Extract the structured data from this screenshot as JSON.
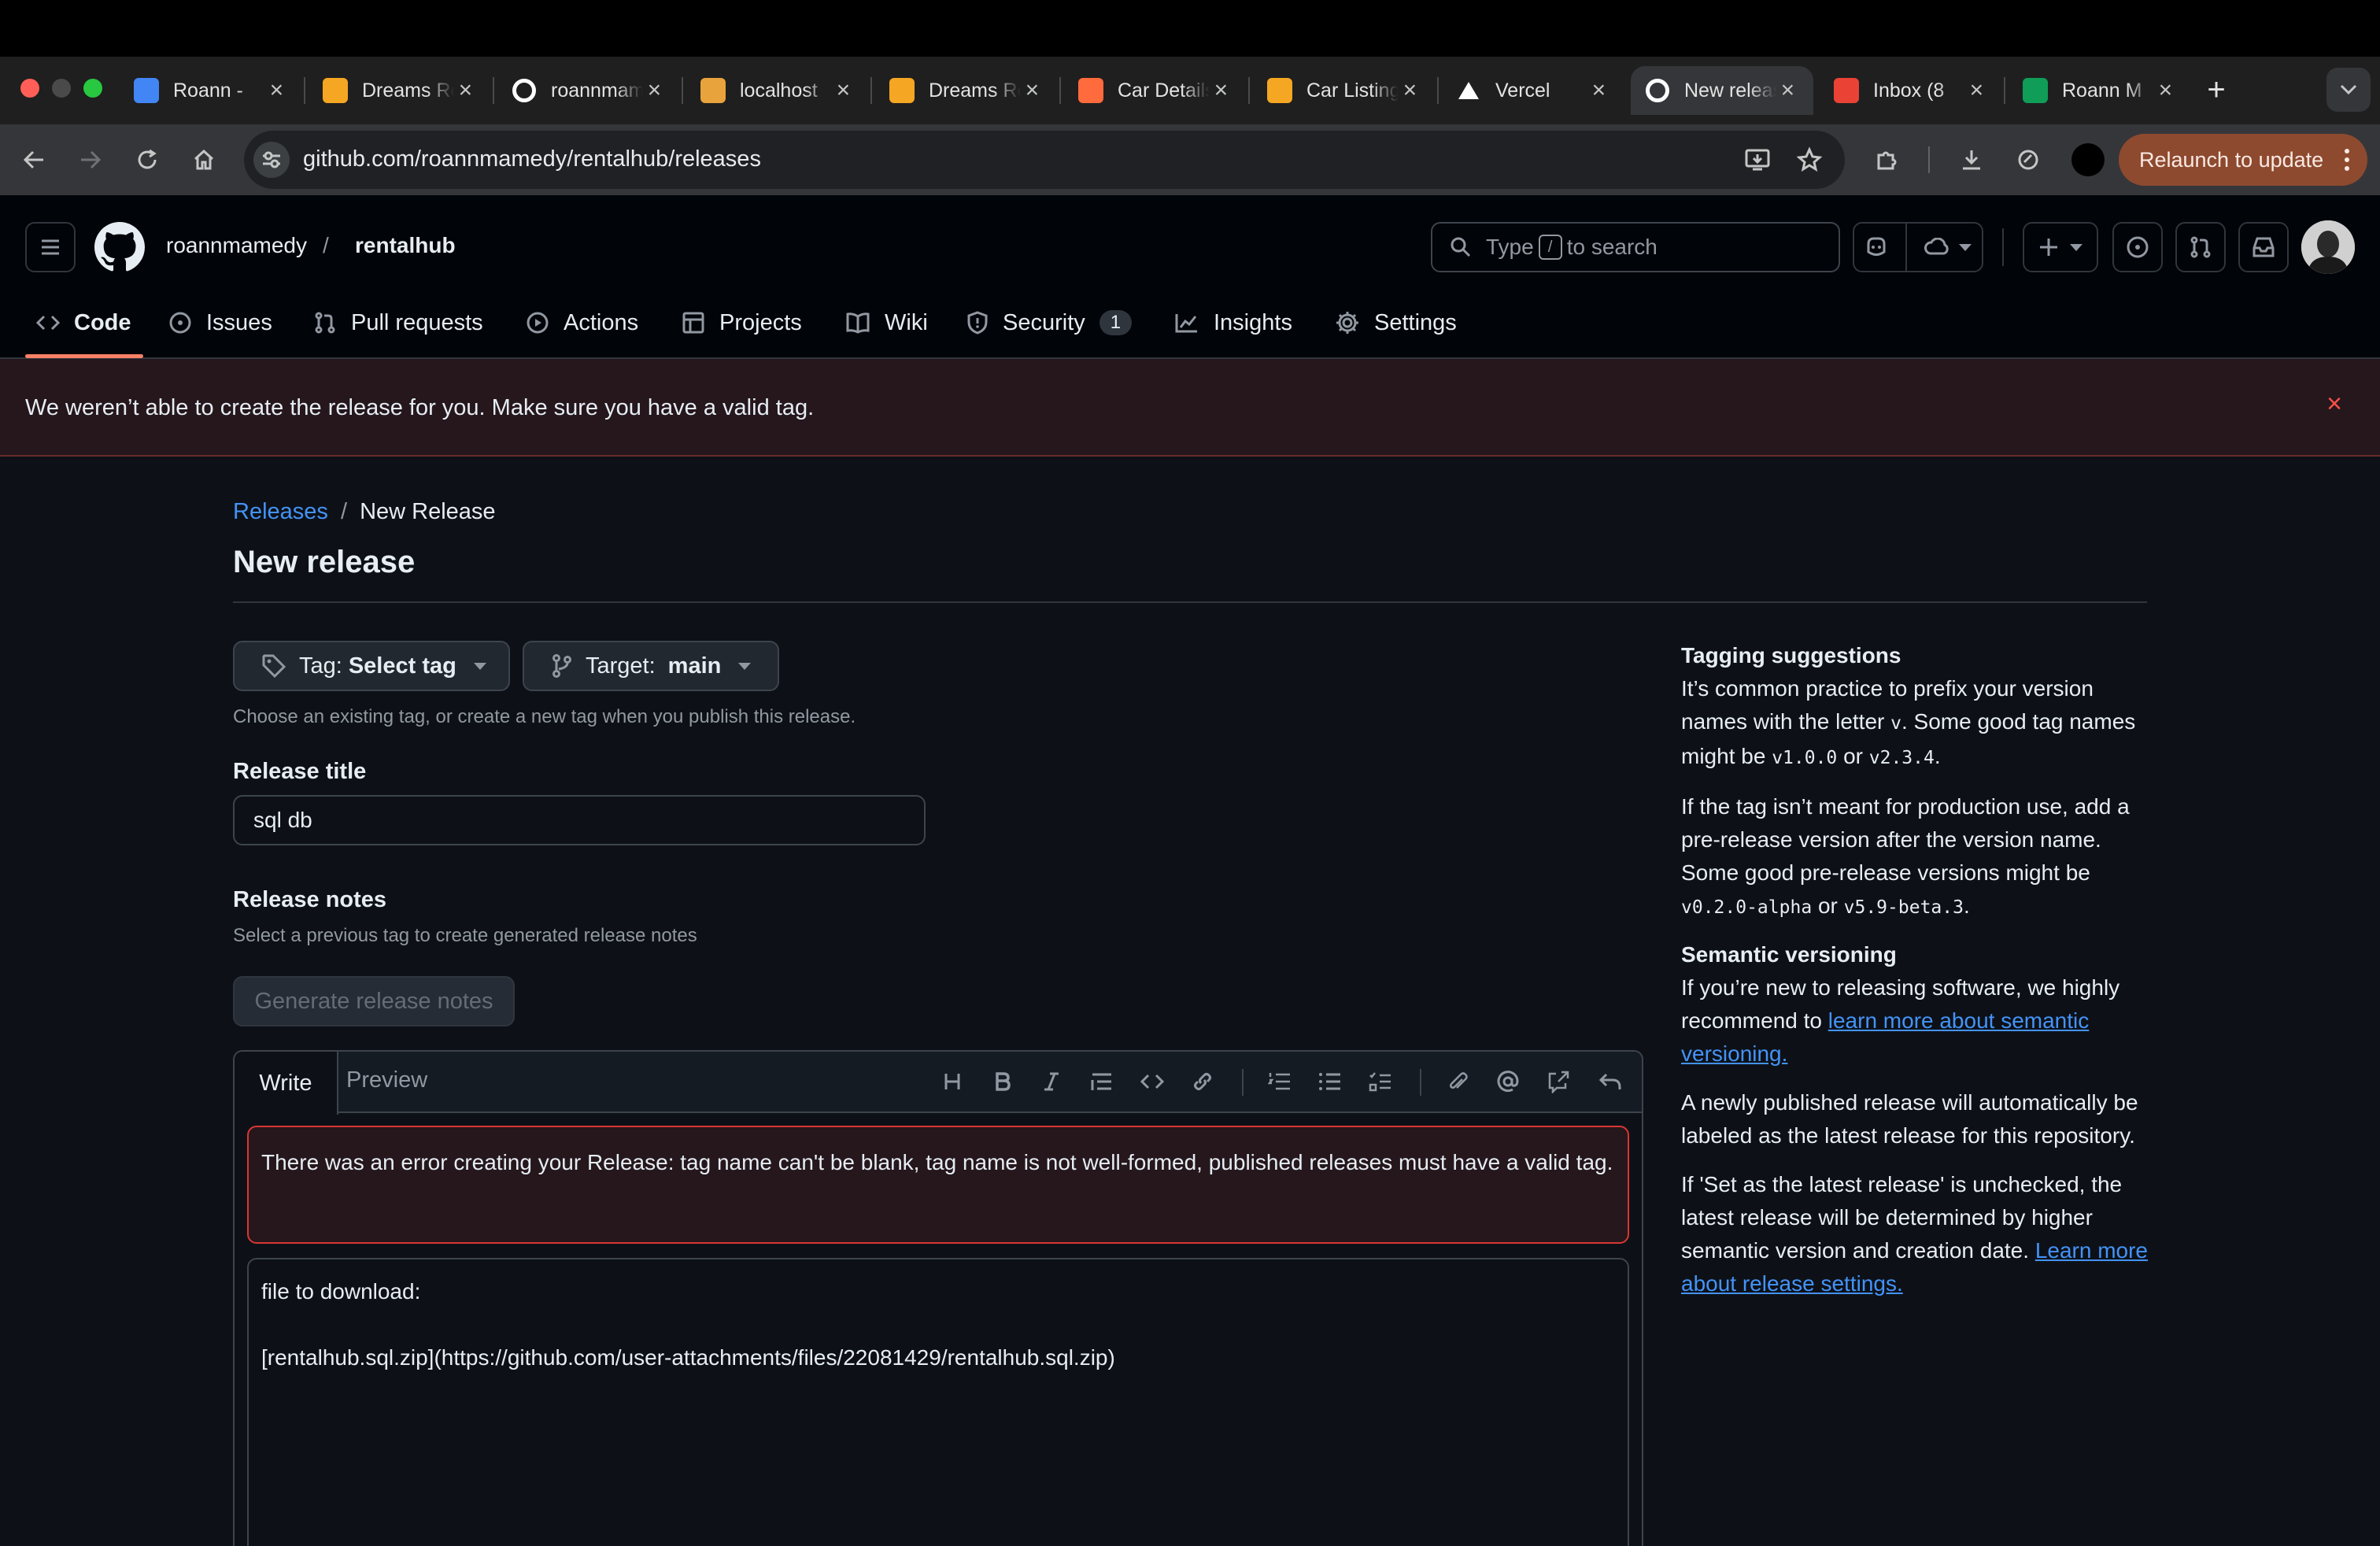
{
  "browser": {
    "tabs": [
      {
        "title": "Roann - ",
        "favicon": "google-docs-icon",
        "color": "#4285f4"
      },
      {
        "title": "Dreams Rent",
        "favicon": "dreams-icon",
        "color": "#f5a623"
      },
      {
        "title": "roannmamedy",
        "favicon": "github-icon",
        "color": "#ffffff"
      },
      {
        "title": "localhost",
        "favicon": "localhost-icon",
        "color": "#e8a33d"
      },
      {
        "title": "Dreams Rent",
        "favicon": "dreams-icon",
        "color": "#f5a623"
      },
      {
        "title": "Car Details",
        "favicon": "car-details-icon",
        "color": "#ff6b3d"
      },
      {
        "title": "Car Listing",
        "favicon": "dreams-icon",
        "color": "#f5a623"
      },
      {
        "title": "Vercel",
        "favicon": "vercel-icon",
        "color": "#ffffff"
      },
      {
        "title": "New release",
        "favicon": "github-icon",
        "color": "#ffffff",
        "active": true
      },
      {
        "title": "Inbox (8",
        "favicon": "gmail-icon",
        "color": "#ea4335"
      },
      {
        "title": "Roann M",
        "favicon": "sheets-icon",
        "color": "#0f9d58"
      }
    ],
    "url": "github.com/roannmamedy/rentalhub/releases",
    "relaunch_label": "Relaunch to update"
  },
  "header": {
    "owner": "roannmamedy",
    "separator": "/",
    "repo": "rentalhub",
    "search_prefix": "Type",
    "search_key": "/",
    "search_suffix": "to search"
  },
  "nav": {
    "code": "Code",
    "issues": "Issues",
    "pulls": "Pull requests",
    "actions": "Actions",
    "projects": "Projects",
    "wiki": "Wiki",
    "security": "Security",
    "security_count": "1",
    "insights": "Insights",
    "settings": "Settings"
  },
  "flash": {
    "message": "We weren’t able to create the release for you. Make sure you have a valid tag."
  },
  "page": {
    "breadcrumb_link": "Releases",
    "breadcrumb_sep": "/",
    "breadcrumb_current": "New Release",
    "title": "New release",
    "tag_label": "Tag:",
    "tag_value": "Select tag",
    "target_label": "Target:",
    "target_value": "main",
    "tag_help": "Choose an existing tag, or create a new tag when you publish this release.",
    "release_title_label": "Release title",
    "release_title_value": "sql db",
    "notes_label": "Release notes",
    "notes_help": "Select a previous tag to create generated release notes",
    "generate_label": "Generate release notes",
    "tab_write": "Write",
    "tab_preview": "Preview",
    "error_message": "There was an error creating your Release: tag name can't be blank, tag name is not well-formed, published releases must have a valid tag.",
    "body_line1": "file to download:",
    "body_line2": "[rentalhub.sql.zip](https://github.com/user-attachments/files/22081429/rentalhub.sql.zip)"
  },
  "sidebar": {
    "tagging_title": "Tagging suggestions",
    "tagging_p1_a": "It’s common practice to prefix your version names with the letter",
    "tagging_p1_code1": "v",
    "tagging_p1_b": ". Some good tag names might be",
    "tagging_p1_code2": "v1.0.0",
    "tagging_p1_c": "or",
    "tagging_p1_code3": "v2.3.4",
    "tagging_p1_d": ".",
    "tagging_p2_a": "If the tag isn’t meant for production use, add a pre-release version after the version name. Some good pre-release versions might be",
    "tagging_p2_code1": "v0.2.0-alpha",
    "tagging_p2_b": "or",
    "tagging_p2_code2": "v5.9-beta.3",
    "tagging_p2_c": ".",
    "semver_title": "Semantic versioning",
    "semver_p1_a": "If you’re new to releasing software, we highly recommend to",
    "semver_p1_link": "learn more about semantic versioning.",
    "semver_p2": "A newly published release will automatically be labeled as the latest release for this repository.",
    "semver_p3_a": "If 'Set as the latest release' is unchecked, the latest release will be determined by higher semantic version and creation date.",
    "semver_p3_link": "Learn more about release settings."
  },
  "colors": {
    "accent_link": "#4493f8",
    "nav_underline": "#f78166",
    "error_border": "#da3633",
    "relaunch_bg": "#8d4a2f"
  }
}
